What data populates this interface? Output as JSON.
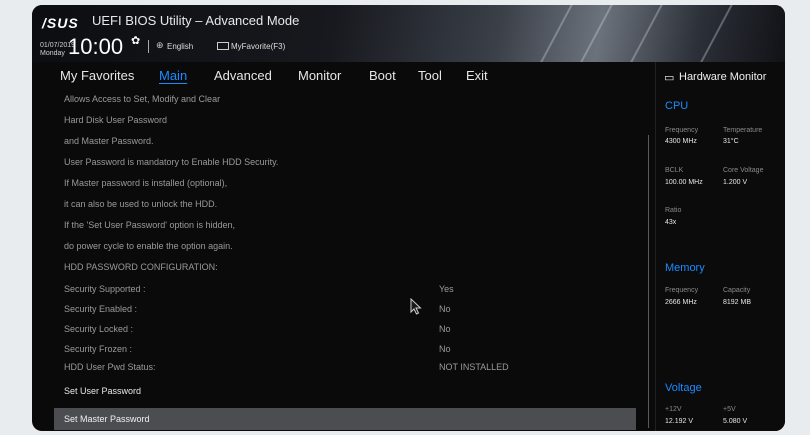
{
  "header": {
    "logo": "/SUS",
    "title": "UEFI BIOS Utility – Advanced Mode",
    "date": "01/07/2019",
    "day": "Monday",
    "time": "10:00",
    "language": "English",
    "favorite": "MyFavorite(F3)"
  },
  "tabs": [
    {
      "label": "My Favorites"
    },
    {
      "label": "Main"
    },
    {
      "label": "Advanced"
    },
    {
      "label": "Monitor"
    },
    {
      "label": "Boot"
    },
    {
      "label": "Tool"
    },
    {
      "label": "Exit"
    }
  ],
  "active_tab": "Main",
  "help_lines": [
    "Allows Access to Set, Modify and Clear",
    "Hard Disk   User   Password",
    "and   Master   Password.",
    "User Password is mandatory to Enable HDD Security.",
    "If Master password is installed (optional),",
    "it can also be used to unlock the HDD.",
    "If the 'Set User Password' option is hidden,",
    "do power cycle to enable the option again.",
    "HDD PASSWORD CONFIGURATION:"
  ],
  "status_rows": [
    {
      "label": "Security Supported :",
      "value": "Yes"
    },
    {
      "label": "Security Enabled   :",
      "value": "No"
    },
    {
      "label": "Security Locked    :",
      "value": "No"
    },
    {
      "label": "Security Frozen    :",
      "value": "No"
    },
    {
      "label": "HDD User Pwd Status:",
      "value": "NOT INSTALLED"
    }
  ],
  "actions": {
    "set_user": "Set User Password",
    "set_master": "Set Master Password"
  },
  "hw_monitor": {
    "title": "Hardware Monitor",
    "cpu": {
      "section": "CPU",
      "frequency_label": "Frequency",
      "frequency": "4300 MHz",
      "temperature_label": "Temperature",
      "temperature": "31°C",
      "bclk_label": "BCLK",
      "bclk": "100.00 MHz",
      "core_voltage_label": "Core Voltage",
      "core_voltage": "1.200 V",
      "ratio_label": "Ratio",
      "ratio": "43x"
    },
    "memory": {
      "section": "Memory",
      "frequency_label": "Frequency",
      "frequency": "2666 MHz",
      "capacity_label": "Capacity",
      "capacity": "8192 MB"
    },
    "voltage": {
      "section": "Voltage",
      "v12_label": "+12V",
      "v12": "12.192 V",
      "v5_label": "+5V",
      "v5": "5.080 V"
    }
  },
  "colors": {
    "accent": "#1a8cff",
    "selected_row": "#4b4d50",
    "background": "#0a0a0b"
  }
}
